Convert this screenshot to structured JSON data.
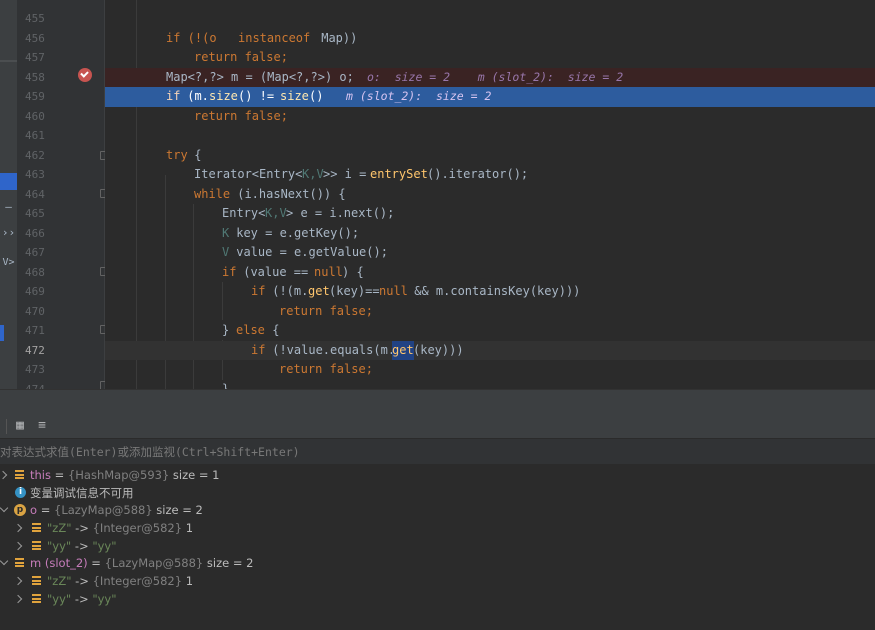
{
  "editor": {
    "lines": [
      {
        "num": "455"
      },
      {
        "num": "456"
      },
      {
        "num": "457"
      },
      {
        "num": "458"
      },
      {
        "num": "459"
      },
      {
        "num": "460"
      },
      {
        "num": "461"
      },
      {
        "num": "462"
      },
      {
        "num": "463"
      },
      {
        "num": "464"
      },
      {
        "num": "465"
      },
      {
        "num": "466"
      },
      {
        "num": "467"
      },
      {
        "num": "468"
      },
      {
        "num": "469"
      },
      {
        "num": "470"
      },
      {
        "num": "471"
      },
      {
        "num": "472"
      },
      {
        "num": "473"
      },
      {
        "num": "474"
      }
    ],
    "code": {
      "l456_a": "if (!(o ",
      "l456_kw": "instanceof",
      "l456_b": " Map))",
      "l457": "return false;",
      "l458_a": "Map<?,?> m = (Map<?,?>) o;",
      "l458_hint": "o:  size = 2    m (slot_2):  size = 2",
      "l459_if": "if",
      "l459_a": " (m.",
      "l459_fn1": "size",
      "l459_b": "() != ",
      "l459_fn2": "size",
      "l459_c": "()",
      "l459_hint": "m (slot_2):  size = 2",
      "l460": "return false;",
      "l462_try": "try",
      "l462_b": " {",
      "l463_a": "Iterator<Entry<",
      "l463_g": "K,V",
      "l463_b": ">> i = ",
      "l463_fn": "entrySet",
      "l463_c": "().iterator();",
      "l464_while": "while",
      "l464_a": " (i.hasNext()) {",
      "l465_a": "Entry<",
      "l465_g": "K,V",
      "l465_b": "> e = i.next();",
      "l466_g": "K",
      "l466_a": " key = e.getKey();",
      "l467_g": "V",
      "l467_a": " value = e.getValue();",
      "l468_if": "if",
      "l468_a": " (value == ",
      "l468_null": "null",
      "l468_b": ") {",
      "l469_if": "if",
      "l469_a": " (!(m.",
      "l469_get": "get",
      "l469_b": "(key)==",
      "l469_null": "null",
      "l469_c": " && m.containsKey(key)))",
      "l470": "return false;",
      "l471_a": "} ",
      "l471_else": "else",
      "l471_b": " {",
      "l472_if": "if",
      "l472_a": " (!value.equals(m.",
      "l472_get": "get",
      "l472_b": "(key)))",
      "l473": "return false;",
      "l474": "}"
    }
  },
  "left_strip": {
    "glyph_1": "—",
    "glyph_2": "››",
    "glyph_3": "V>"
  },
  "debugger": {
    "eval_placeholder": "对表达式求值(Enter)或添加监视(Ctrl+Shift+Enter)",
    "toolbar_icons": [
      "table-icon",
      "list-icon"
    ],
    "variables": [
      {
        "name": "this",
        "eq": " = ",
        "val": "{HashMap@593}",
        "extra": "  size = 1"
      },
      {
        "info": "变量调试信息不可用"
      },
      {
        "name": "o",
        "eq": " = ",
        "val": "{LazyMap@588}",
        "extra": "  size = 2"
      },
      {
        "key": "\"zZ\"",
        "arrow": " -> ",
        "val": "{Integer@582}",
        "extra": " 1"
      },
      {
        "key": "\"yy\"",
        "arrow": " -> ",
        "val": "\"yy\""
      },
      {
        "name": "m (slot_2)",
        "eq": " = ",
        "val": "{LazyMap@588}",
        "extra": "  size = 2"
      },
      {
        "key": "\"zZ\"",
        "arrow": " -> ",
        "val": "{Integer@582}",
        "extra": " 1"
      },
      {
        "key": "\"yy\"",
        "arrow": " -> ",
        "val": "\"yy\""
      }
    ]
  }
}
